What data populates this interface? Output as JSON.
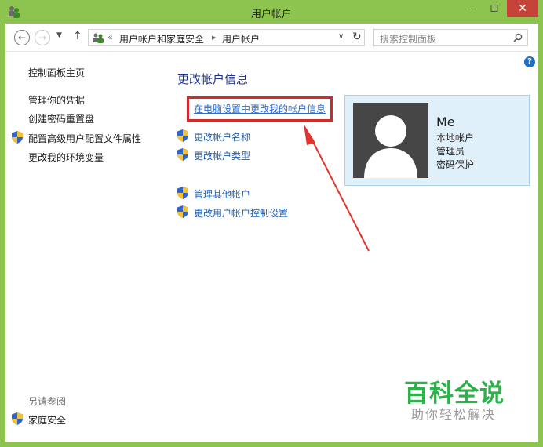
{
  "window": {
    "title": "用户帐户"
  },
  "titlebar": {
    "minimize": "—",
    "maximize": "☐",
    "close": "✕"
  },
  "nav": {
    "breadcrumbs": [
      "用户帐户和家庭安全",
      "用户帐户"
    ],
    "search_placeholder": "搜索控制面板"
  },
  "sidebar": {
    "items": [
      {
        "label": "控制面板主页",
        "shield": false
      },
      {
        "label": "管理你的凭据",
        "shield": false
      },
      {
        "label": "创建密码重置盘",
        "shield": false
      },
      {
        "label": "配置高级用户配置文件属性",
        "shield": true
      },
      {
        "label": "更改我的环境变量",
        "shield": false
      }
    ],
    "see_also_label": "另请参阅",
    "see_also_items": [
      {
        "label": "家庭安全",
        "shield": true
      }
    ]
  },
  "main": {
    "heading": "更改帐户信息",
    "highlighted_link": "在电脑设置中更改我的帐户信息",
    "links": [
      {
        "label": "更改帐户名称",
        "shield": true
      },
      {
        "label": "更改帐户类型",
        "shield": true
      },
      {
        "label": "管理其他帐户",
        "shield": true
      },
      {
        "label": "更改用户帐户控制设置",
        "shield": true
      }
    ]
  },
  "user_card": {
    "name": "Me",
    "details": [
      "本地帐户",
      "管理员",
      "密码保护"
    ]
  },
  "watermark": {
    "title": "百科全说",
    "subtitle": "助你轻松解决"
  },
  "colors": {
    "titlebar": "#8dc44f",
    "close": "#c6433a",
    "link": "#1a5cb3",
    "heading": "#1e3287",
    "annotation_red": "#d22a2a",
    "card_bg": "#dff0fb",
    "watermark_green": "#2db14a"
  }
}
